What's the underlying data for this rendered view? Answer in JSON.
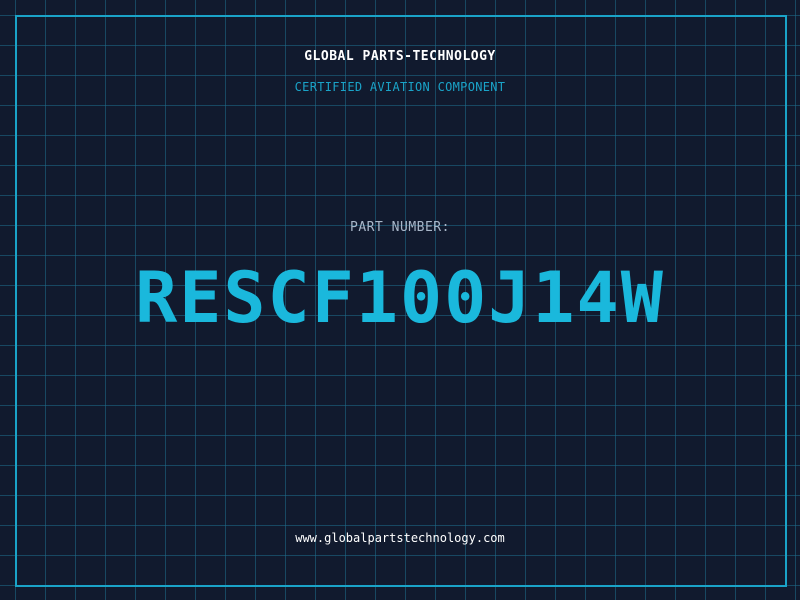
{
  "header": {
    "company": "GLOBAL PARTS-TECHNOLOGY",
    "tagline": "CERTIFIED AVIATION COMPONENT"
  },
  "part": {
    "label": "PART NUMBER:",
    "number": "RESCF100J14W"
  },
  "footer": {
    "website": "www.globalpartstechnology.com"
  },
  "colors": {
    "background": "#111a2e",
    "grid": "#1e6e8c",
    "accent": "#1ab8dc",
    "label": "#a9b7c9",
    "text": "#ffffff"
  }
}
